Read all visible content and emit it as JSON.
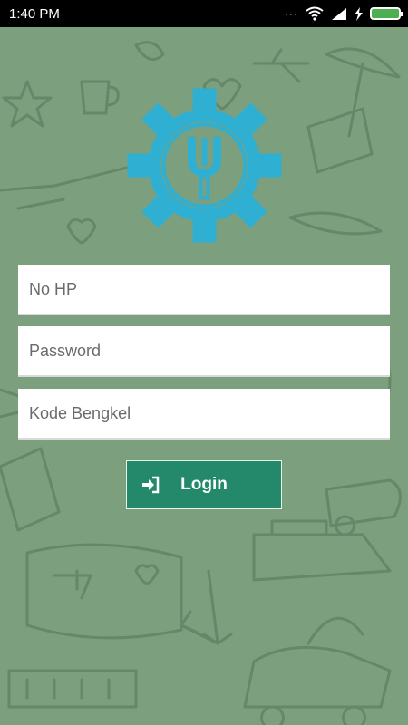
{
  "status_bar": {
    "time": "1:40 PM",
    "overflow_dots": "···",
    "icons": [
      "wifi-icon",
      "signal-icon",
      "charging-icon",
      "battery-icon"
    ]
  },
  "logo": {
    "icon": "gear-wrench-logo",
    "color": "#2fb0d3"
  },
  "form": {
    "phone_placeholder": "No HP",
    "password_placeholder": "Password",
    "workshop_code_placeholder": "Kode Bengkel",
    "login_label": "Login"
  },
  "colors": {
    "background": "#7c9f7e",
    "button": "#23896a",
    "doodle": "#5f7f62"
  }
}
